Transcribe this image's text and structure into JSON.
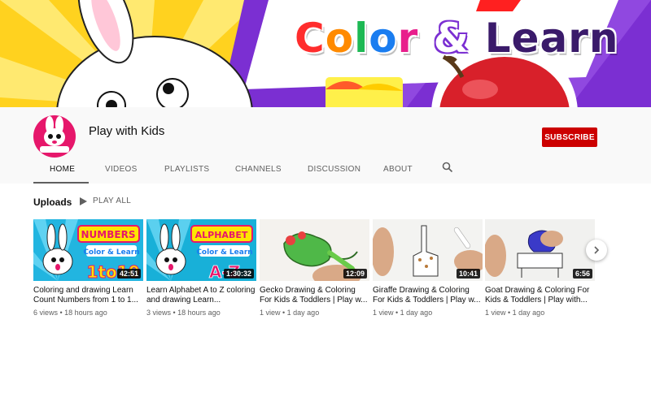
{
  "banner": {
    "title_word1_letters": [
      "C",
      "o",
      "l",
      "o",
      "r"
    ],
    "title_word1_colors": [
      "#ff2d2d",
      "#ff8a00",
      "#1db954",
      "#1a7df0",
      "#e81e8c"
    ],
    "title_amp": "&",
    "title_word2": "Learn"
  },
  "channel": {
    "name": "Play with Kids",
    "avatar_text": "Play with Kids",
    "subscribe_label": "SUBSCRIBE"
  },
  "tabs": [
    {
      "label": "HOME",
      "active": true
    },
    {
      "label": "VIDEOS"
    },
    {
      "label": "PLAYLISTS"
    },
    {
      "label": "CHANNELS"
    },
    {
      "label": "DISCUSSION"
    },
    {
      "label": "ABOUT"
    }
  ],
  "uploads": {
    "title": "Uploads",
    "play_all_label": "PLAY ALL",
    "videos": [
      {
        "title": "Coloring and drawing Learn Count Numbers from 1 to 1...",
        "duration": "42:51",
        "meta": "6 views • 18 hours ago",
        "thumb_text_top": "NUMBERS",
        "thumb_text_mid": "Color & Learn",
        "thumb_text_big": "1to10"
      },
      {
        "title": "Learn Alphabet A to Z coloring and drawing Learn...",
        "duration": "1:30:32",
        "meta": "3 views • 18 hours ago",
        "thumb_text_top": "ALPHABET",
        "thumb_text_mid": "Color & Learn",
        "thumb_text_big": "A-Z"
      },
      {
        "title": "Gecko Drawing & Coloring For Kids & Toddlers | Play w...",
        "duration": "12:09",
        "meta": "1 view • 1 day ago"
      },
      {
        "title": "Giraffe Drawing & Coloring For Kids & Toddlers | Play w...",
        "duration": "10:41",
        "meta": "1 view • 1 day ago"
      },
      {
        "title": "Goat Drawing & Coloring For Kids & Toddlers | Play with...",
        "duration": "6:56",
        "meta": "1 view • 1 day ago"
      }
    ]
  },
  "icons": {
    "search": "search-icon",
    "play": "play-icon",
    "next": "chevron-right-icon"
  },
  "colors": {
    "subscribe": "#cc0000",
    "header_bg": "#f9f9f9",
    "avatar_bg": "#e6176b"
  }
}
